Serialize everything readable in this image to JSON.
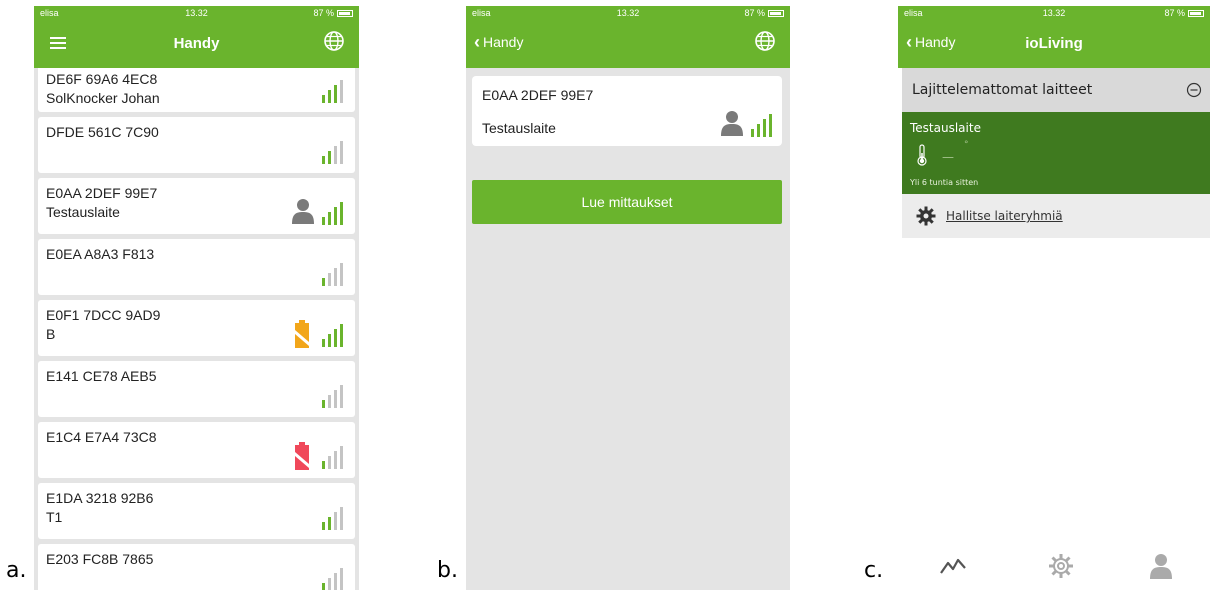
{
  "panel_labels": [
    "a.",
    "b.",
    "c."
  ],
  "status_bar": {
    "carrier": "elisa",
    "time": "13.32",
    "battery": "87 %"
  },
  "colors": {
    "brand_green": "#6ab42d",
    "dark_green": "#3f7a1f",
    "signal_inactive": "#c4c4c4",
    "battery_ok": "#f2a61a",
    "battery_low": "#f0485a",
    "person_grey": "#7a7a7a"
  },
  "panel_a": {
    "nav_title": "Handy",
    "icons": {
      "left": "menu-icon",
      "right": "globe-icon"
    },
    "devices": [
      {
        "id": "DE6F 69A6 4EC8",
        "name": "SolKnocker Johan",
        "signal_bars": 3,
        "owner_icon": false,
        "battery": ""
      },
      {
        "id": "DFDE 561C 7C90",
        "name": "",
        "signal_bars": 2,
        "owner_icon": false,
        "battery": ""
      },
      {
        "id": "E0AA 2DEF 99E7",
        "name": "Testauslaite",
        "signal_bars": 4,
        "owner_icon": true,
        "battery": ""
      },
      {
        "id": "E0EA A8A3 F813",
        "name": "",
        "signal_bars": 1,
        "owner_icon": false,
        "battery": ""
      },
      {
        "id": "E0F1 7DCC 9AD9",
        "name": "B",
        "signal_bars": 4,
        "owner_icon": false,
        "battery": "ok"
      },
      {
        "id": "E141 CE78 AEB5",
        "name": "",
        "signal_bars": 1,
        "owner_icon": false,
        "battery": ""
      },
      {
        "id": "E1C4 E7A4 73C8",
        "name": "",
        "signal_bars": 1,
        "owner_icon": false,
        "battery": "low"
      },
      {
        "id": "E1DA 3218 92B6",
        "name": "T1",
        "signal_bars": 2,
        "owner_icon": false,
        "battery": ""
      },
      {
        "id": "E203 FC8B 7865",
        "name": "",
        "signal_bars": 1,
        "owner_icon": false,
        "battery": ""
      }
    ]
  },
  "panel_b": {
    "back_label": "Handy",
    "icons": {
      "right": "globe-icon"
    },
    "device": {
      "id": "E0AA 2DEF 99E7",
      "name": "Testauslaite",
      "signal_bars": 4
    },
    "read_button": "Lue mittaukset"
  },
  "panel_c": {
    "back_label": "Handy",
    "nav_title": "ioLiving",
    "section_title": "Lajittelemattomat laitteet",
    "sensor": {
      "name": "Testauslaite",
      "value": "—",
      "unit": "°",
      "updated": "Yli 6 tuntia sitten"
    },
    "manage_label": "Hallitse laiteryhmiä",
    "tabs": [
      "activity-icon",
      "settings-icon",
      "profile-icon"
    ]
  }
}
